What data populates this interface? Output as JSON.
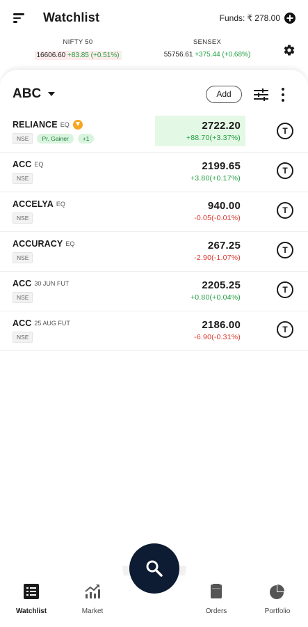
{
  "header": {
    "title": "Watchlist",
    "funds_label": "Funds:",
    "funds_value": "₹ 278.00"
  },
  "indices": [
    {
      "name": "NIFTY 50",
      "value": "16606.60",
      "change": "+83.85 (+0.51%)"
    },
    {
      "name": "SENSEX",
      "value": "55756.61",
      "change": "+375.44 (+0.68%)"
    }
  ],
  "watchlist": {
    "name": "ABC",
    "add_label": "Add",
    "rows": [
      {
        "symbol": "RELIANCE",
        "series": "EQ",
        "exchange": "NSE",
        "tags": [
          "Pr. Gainer",
          "+1"
        ],
        "ltp": "2722.20",
        "change": "+88.70(+3.37%)",
        "direction": "up",
        "highlight": true
      },
      {
        "symbol": "ACC",
        "series": "EQ",
        "exchange": "NSE",
        "tags": [],
        "ltp": "2199.65",
        "change": "+3.80(+0.17%)",
        "direction": "up",
        "highlight": false
      },
      {
        "symbol": "ACCELYA",
        "series": "EQ",
        "exchange": "NSE",
        "tags": [],
        "ltp": "940.00",
        "change": "-0.05(-0.01%)",
        "direction": "down",
        "highlight": false
      },
      {
        "symbol": "ACCURACY",
        "series": "EQ",
        "exchange": "NSE",
        "tags": [],
        "ltp": "267.25",
        "change": "-2.90(-1.07%)",
        "direction": "down",
        "highlight": false
      },
      {
        "symbol": "ACC",
        "series": "30 JUN FUT",
        "exchange": "NSE",
        "tags": [],
        "ltp": "2205.25",
        "change": "+0.80(+0.04%)",
        "direction": "up",
        "highlight": false
      },
      {
        "symbol": "ACC",
        "series": "25 AUG FUT",
        "exchange": "NSE",
        "tags": [],
        "ltp": "2186.00",
        "change": "-6.90(-0.31%)",
        "direction": "down",
        "highlight": false
      }
    ],
    "trade_glyph": "T"
  },
  "nav": [
    {
      "label": "Watchlist",
      "icon": "watchlist-icon",
      "active": true
    },
    {
      "label": "Market",
      "icon": "market-icon",
      "active": false
    },
    {
      "label": "Orders",
      "icon": "orders-icon",
      "active": false
    },
    {
      "label": "Portfolio",
      "icon": "portfolio-icon",
      "active": false
    }
  ],
  "fab": {
    "icon": "search-icon"
  },
  "colors": {
    "up": "#1e9e3e",
    "down": "#d9342b",
    "fab": "#0d1b33",
    "highlight": "#e4f8e6"
  }
}
